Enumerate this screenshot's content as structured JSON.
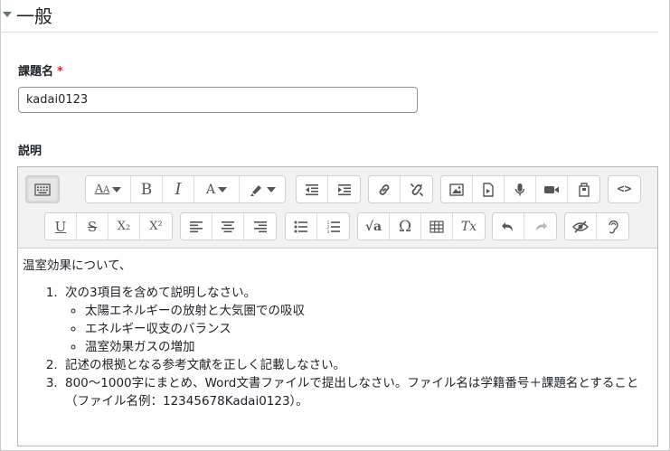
{
  "section": {
    "title": "一般"
  },
  "assignment_name": {
    "label": "課題名",
    "required_mark": "*",
    "value": "kadai0123"
  },
  "description": {
    "label": "説明",
    "toolbar": {
      "row1": [
        {
          "name": "toolbar-toggle-button",
          "icon": "keyboard-icon"
        },
        {
          "name": "font-style-button",
          "icon": "font-style-icon"
        },
        {
          "name": "bold-button",
          "icon": "bold-icon",
          "glyph": "B"
        },
        {
          "name": "italic-button",
          "icon": "italic-icon",
          "glyph": "I"
        },
        {
          "name": "font-color-button",
          "icon": "font-color-icon",
          "glyph": "A"
        },
        {
          "name": "background-color-button",
          "icon": "highlighter-icon"
        },
        {
          "name": "outdent-button",
          "icon": "outdent-icon"
        },
        {
          "name": "indent-button",
          "icon": "indent-icon"
        },
        {
          "name": "link-button",
          "icon": "link-icon"
        },
        {
          "name": "unlink-button",
          "icon": "unlink-icon"
        },
        {
          "name": "image-button",
          "icon": "image-icon"
        },
        {
          "name": "media-button",
          "icon": "media-icon"
        },
        {
          "name": "record-audio-button",
          "icon": "microphone-icon"
        },
        {
          "name": "record-video-button",
          "icon": "video-camera-icon"
        },
        {
          "name": "manage-files-button",
          "icon": "files-icon"
        },
        {
          "name": "html-button",
          "icon": "code-icon",
          "glyph": "<>"
        }
      ],
      "row2": [
        {
          "name": "underline-button",
          "icon": "underline-icon",
          "glyph": "U"
        },
        {
          "name": "strikethrough-button",
          "icon": "strikethrough-icon",
          "glyph": "S"
        },
        {
          "name": "subscript-button",
          "icon": "subscript-icon",
          "glyph": "X₂"
        },
        {
          "name": "superscript-button",
          "icon": "superscript-icon",
          "glyph": "X²"
        },
        {
          "name": "align-left-button",
          "icon": "align-left-icon"
        },
        {
          "name": "align-center-button",
          "icon": "align-center-icon"
        },
        {
          "name": "align-right-button",
          "icon": "align-right-icon"
        },
        {
          "name": "unordered-list-button",
          "icon": "bullet-list-icon"
        },
        {
          "name": "ordered-list-button",
          "icon": "numbered-list-icon"
        },
        {
          "name": "equation-button",
          "icon": "square-root-icon",
          "glyph": "√a"
        },
        {
          "name": "special-chars-button",
          "icon": "omega-icon",
          "glyph": "Ω"
        },
        {
          "name": "table-button",
          "icon": "table-icon"
        },
        {
          "name": "clear-formatting-button",
          "icon": "clear-formatting-icon",
          "glyph": "Tx"
        },
        {
          "name": "undo-button",
          "icon": "undo-icon"
        },
        {
          "name": "redo-button",
          "icon": "redo-icon"
        },
        {
          "name": "accessibility-checker-button",
          "icon": "eye-slash-icon"
        },
        {
          "name": "screenreader-helper-button",
          "icon": "ear-icon"
        }
      ]
    },
    "content": {
      "intro": "温室効果について、",
      "items": [
        {
          "text": "次の3項目を含めて説明しなさい。",
          "subitems": [
            "太陽エネルギーの放射と大気圏での吸収",
            "エネルギー収支のバランス",
            "温室効果ガスの増加"
          ]
        },
        {
          "text": "記述の根拠となる参考文献を正しく記載しなさい。"
        },
        {
          "text": "800～1000字にまとめ、Word文書ファイルで提出しなさい。ファイル名は学籍番号＋課題名とすること（ファイル名例：12345678Kadai0123）。"
        }
      ]
    }
  }
}
